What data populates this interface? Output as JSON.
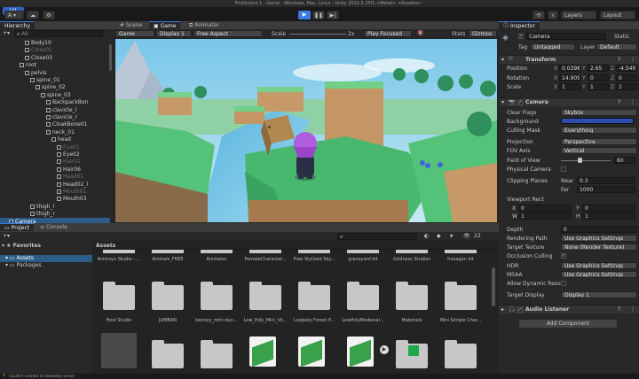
{
  "window": {
    "title": "FirstScene 1 - Game - Windows, Mac, Linux - Unity 2022.3.25f1 <Metal> <Rosetta>"
  },
  "toolbar": {
    "account_label": "A ▾",
    "layers_label": "Layers",
    "layout_label": "Layout"
  },
  "hierarchy": {
    "tab_label": "Hierarchy",
    "search_placeholder": "All",
    "items": [
      {
        "label": "Body10",
        "depth": 4,
        "dim": false
      },
      {
        "label": "Close01",
        "depth": 4,
        "dim": true
      },
      {
        "label": "Close03",
        "depth": 4,
        "dim": false
      },
      {
        "label": "root",
        "depth": 3,
        "dim": false
      },
      {
        "label": "pelvis",
        "depth": 4,
        "dim": false
      },
      {
        "label": "spine_01",
        "depth": 5,
        "dim": false
      },
      {
        "label": "spine_02",
        "depth": 6,
        "dim": false
      },
      {
        "label": "spine_03",
        "depth": 7,
        "dim": false
      },
      {
        "label": "BackpackBon",
        "depth": 8,
        "dim": false
      },
      {
        "label": "clavicle_l",
        "depth": 8,
        "dim": false
      },
      {
        "label": "clavicle_r",
        "depth": 8,
        "dim": false
      },
      {
        "label": "CloakBone01",
        "depth": 8,
        "dim": false
      },
      {
        "label": "neck_01",
        "depth": 8,
        "dim": false
      },
      {
        "label": "head",
        "depth": 9,
        "dim": false
      },
      {
        "label": "Eye01",
        "depth": 10,
        "dim": true
      },
      {
        "label": "Eye02",
        "depth": 10,
        "dim": false
      },
      {
        "label": "Hair01",
        "depth": 10,
        "dim": true
      },
      {
        "label": "Hair06",
        "depth": 10,
        "dim": false
      },
      {
        "label": "Head01",
        "depth": 10,
        "dim": true
      },
      {
        "label": "Head02_l",
        "depth": 10,
        "dim": false
      },
      {
        "label": "Mouth01",
        "depth": 10,
        "dim": true
      },
      {
        "label": "Mouth03",
        "depth": 10,
        "dim": false
      },
      {
        "label": "thigh_l",
        "depth": 5,
        "dim": false
      },
      {
        "label": "thigh_r",
        "depth": 5,
        "dim": false
      },
      {
        "label": "Camera",
        "depth": 1,
        "dim": false
      }
    ]
  },
  "viewport": {
    "tabs": [
      "Scene",
      "Game",
      "Animator"
    ],
    "display_options": [
      "Game",
      "Display 1",
      "Free Aspect"
    ],
    "scale_label": "Scale",
    "scale_value": "2x",
    "play_focused_label": "Play Focused",
    "stats_label": "Stats",
    "gizmos_label": "Gizmos"
  },
  "project": {
    "tabs": [
      "Project",
      "Console"
    ],
    "sidebar": [
      {
        "label": "Favorites",
        "icon": "star-icon"
      },
      {
        "label": "Assets",
        "icon": "folder-icon"
      },
      {
        "label": "Packages",
        "icon": "folder-icon"
      }
    ],
    "breadcrumb": "Assets",
    "hidden_count": "22",
    "top_labels": [
      "Animsyn Studio - ...",
      "Animals_FREE",
      "Animator",
      "FemaleCharacter...",
      "Free Stylized Sky...",
      "graveyard kit",
      "Gridness Studios",
      "hexagon kit"
    ],
    "row1": [
      "Hovl Studio",
      "JUMBAN",
      "kenney_mini-dun...",
      "Low_Poly_Mini_Vil...",
      "Lowpoly Forest P...",
      "LowPolyMedieval...",
      "Materials",
      "Mini Simple Char..."
    ],
    "status_text": "Couldn't connect to telemetry server - "
  },
  "inspector": {
    "tab_label": "Inspector",
    "object_name": "Camera",
    "static_label": "Static",
    "tag_label": "Tag",
    "tag_value": "Untagged",
    "layer_label": "Layer",
    "layer_value": "Default",
    "transform": {
      "title": "Transform",
      "position_label": "Position",
      "position": [
        "0.0398",
        "2.65",
        "-4.540"
      ],
      "rotation_label": "Rotation",
      "rotation": [
        "14.905",
        "0",
        "0"
      ],
      "scale_label": "Scale",
      "scale": [
        "1",
        "1",
        "1"
      ]
    },
    "camera": {
      "title": "Camera",
      "props": [
        {
          "label": "Clear Flags",
          "value": "Skybox"
        },
        {
          "label": "Background",
          "value": ""
        },
        {
          "label": "Culling Mask",
          "value": "Everything"
        },
        {
          "label": "Projection",
          "value": "Perspective"
        },
        {
          "label": "FOV Axis",
          "value": "Vertical"
        },
        {
          "label": "Field of View",
          "value": "60"
        },
        {
          "label": "Physical Camera",
          "value": ""
        }
      ],
      "clipping_label": "Clipping Planes",
      "near_label": "Near",
      "near_value": "0.3",
      "far_label": "Far",
      "far_value": "1000",
      "viewport_label": "Viewport Rect",
      "rect": [
        {
          "k": "X",
          "v": "0"
        },
        {
          "k": "Y",
          "v": "0"
        },
        {
          "k": "W",
          "v": "1"
        },
        {
          "k": "H",
          "v": "1"
        }
      ],
      "props2": [
        {
          "label": "Depth",
          "value": "0"
        },
        {
          "label": "Rendering Path",
          "value": "Use Graphics Settings"
        },
        {
          "label": "Target Texture",
          "value": "None (Render Texture)"
        },
        {
          "label": "Occlusion Culling",
          "value": "✓"
        },
        {
          "label": "HDR",
          "value": "Use Graphics Settings"
        },
        {
          "label": "MSAA",
          "value": "Use Graphics Settings"
        },
        {
          "label": "Allow Dynamic Resol",
          "value": ""
        },
        {
          "label": "Target Display",
          "value": "Display 1"
        }
      ]
    },
    "audio_listener_label": "Audio Listener",
    "add_component_label": "Add Component"
  },
  "colors": {
    "accent": "#3d7ae6",
    "background_swatch": "#2f4cb0"
  }
}
